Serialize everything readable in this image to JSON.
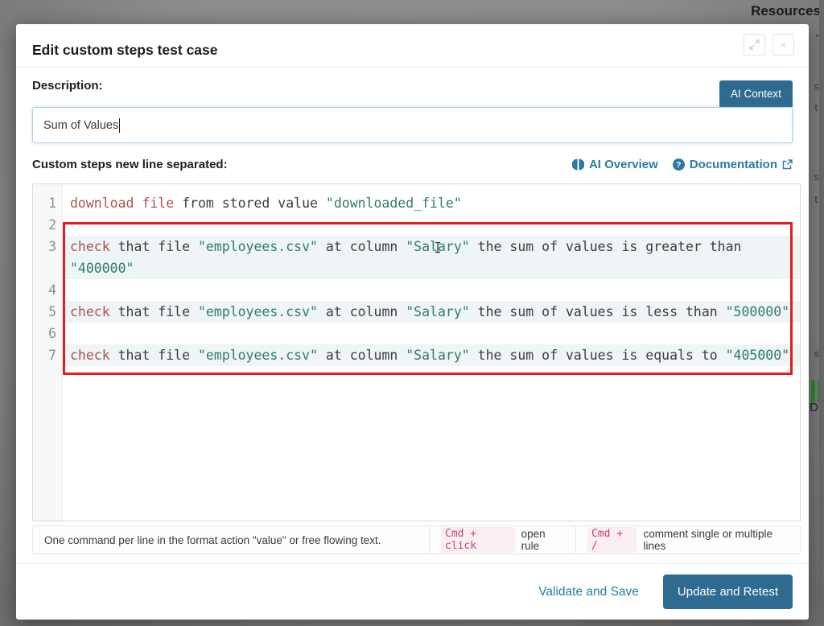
{
  "background": {
    "resources_label": "Resources",
    "fragments": [
      "\"",
      "s",
      "t",
      "s",
      "t",
      "s",
      "D"
    ]
  },
  "modal": {
    "title": "Edit custom steps test case",
    "window_controls": {
      "close_glyph": "×"
    },
    "description": {
      "label": "Description:",
      "value": "Sum of Values",
      "ai_context_button": "AI Context"
    },
    "steps_header": {
      "label": "Custom steps new line separated:",
      "ai_overview_link": "AI Overview",
      "documentation_link": "Documentation"
    },
    "editor": {
      "rows": [
        {
          "num": "1",
          "hl": false,
          "segs": [
            {
              "c": "kw",
              "t": "download file"
            },
            {
              "c": "pl",
              "t": " from stored value "
            },
            {
              "c": "str",
              "t": "\"downloaded_file\""
            }
          ]
        },
        {
          "num": "2",
          "hl": false,
          "segs": []
        },
        {
          "num": "3",
          "hl": true,
          "segs": [
            {
              "c": "kw",
              "t": "check"
            },
            {
              "c": "pl",
              "t": " that file "
            },
            {
              "c": "str",
              "t": "\"employees.csv\""
            },
            {
              "c": "pl",
              "t": " at column "
            },
            {
              "c": "str",
              "t": "\"Salary\""
            },
            {
              "c": "pl",
              "t": " the sum of values is greater than"
            }
          ]
        },
        {
          "num": "",
          "hl": true,
          "segs": [
            {
              "c": "str",
              "t": "\"400000\""
            }
          ]
        },
        {
          "num": "4",
          "hl": false,
          "segs": []
        },
        {
          "num": "5",
          "hl": true,
          "segs": [
            {
              "c": "kw",
              "t": "check"
            },
            {
              "c": "pl",
              "t": " that file "
            },
            {
              "c": "str",
              "t": "\"employees.csv\""
            },
            {
              "c": "pl",
              "t": " at column "
            },
            {
              "c": "str",
              "t": "\"Salary\""
            },
            {
              "c": "pl",
              "t": " the sum of values is less than "
            },
            {
              "c": "str",
              "t": "\"500000\""
            }
          ]
        },
        {
          "num": "6",
          "hl": false,
          "segs": []
        },
        {
          "num": "7",
          "hl": true,
          "segs": [
            {
              "c": "kw",
              "t": "check"
            },
            {
              "c": "pl",
              "t": " that file "
            },
            {
              "c": "str",
              "t": "\"employees.csv\""
            },
            {
              "c": "pl",
              "t": " at column "
            },
            {
              "c": "str",
              "t": "\"Salary\""
            },
            {
              "c": "pl",
              "t": " the sum of values is equals to "
            },
            {
              "c": "str",
              "t": "\"405000\""
            }
          ]
        }
      ]
    },
    "hintbar": {
      "hint": "One command per line in the format action \"value\" or free flowing text.",
      "cmd_click_chip": "Cmd + click",
      "cmd_click_desc": "open rule",
      "cmd_slash_chip": "Cmd + /",
      "cmd_slash_desc": "comment single or multiple lines"
    },
    "footer": {
      "validate_button": "Validate and Save",
      "update_button": "Update and Retest"
    }
  },
  "colors": {
    "accent_teal_link": "#2a7ba3",
    "accent_button_bg": "#2d6b91",
    "keyword": "#a7564e",
    "string": "#2e7c6c",
    "annotation_red": "#e51c1c"
  }
}
